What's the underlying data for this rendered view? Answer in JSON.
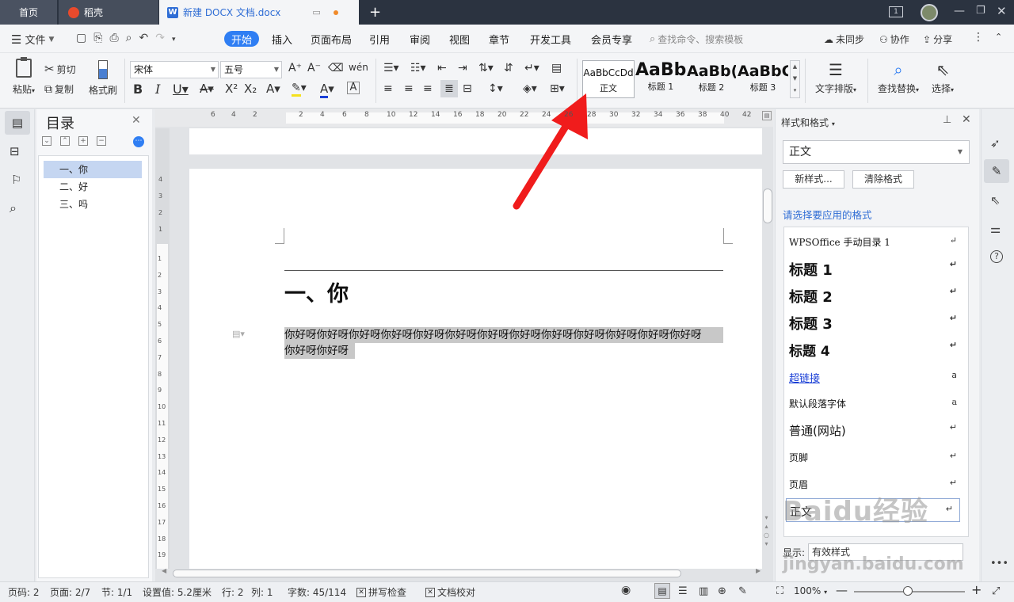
{
  "tabs": {
    "home": "首页",
    "daoke": "稻壳",
    "doc": "新建 DOCX 文档.docx"
  },
  "titlebar": {
    "page_count": "1"
  },
  "menu": {
    "file": "文件",
    "items": [
      "开始",
      "插入",
      "页面布局",
      "引用",
      "审阅",
      "视图",
      "章节",
      "开发工具",
      "会员专享"
    ],
    "search": "查找命令、搜索模板",
    "sync": "未同步",
    "collab": "协作",
    "share": "分享"
  },
  "ribbon": {
    "paste": "粘贴",
    "cut": "剪切",
    "copy": "复制",
    "format_painter": "格式刷",
    "font_name": "宋体",
    "font_size": "五号",
    "styles": [
      {
        "sample": "AaBbCcDd",
        "caption": "正文"
      },
      {
        "sample": "AaBb",
        "caption": "标题 1"
      },
      {
        "sample": "AaBb(",
        "caption": "标题 2"
      },
      {
        "sample": "AaBbC",
        "caption": "标题 3"
      }
    ],
    "text_layout": "文字排版",
    "find_replace": "查找替换",
    "select": "选择"
  },
  "toc": {
    "title": "目录",
    "items": [
      "一、你",
      "二、好",
      "三、吗"
    ]
  },
  "ruler": {
    "h_ticks": [
      "6",
      "4",
      "2",
      "2",
      "4",
      "6",
      "8",
      "10",
      "12",
      "14",
      "16",
      "18",
      "20",
      "22",
      "24",
      "26",
      "28",
      "30",
      "32",
      "34",
      "36",
      "38",
      "40",
      "42"
    ],
    "v_ticks_top": [
      "4",
      "3",
      "2",
      "1"
    ],
    "v_ticks": [
      "1",
      "2",
      "3",
      "4",
      "5",
      "6",
      "7",
      "8",
      "9",
      "10",
      "11",
      "12",
      "13",
      "14",
      "15",
      "16",
      "17",
      "18",
      "19"
    ]
  },
  "document": {
    "heading": "一、你",
    "paragraph_line1": "你好呀你好呀你好呀你好呀你好呀你好呀你好呀你好呀你好呀你好呀你好呀你好呀你好呀",
    "paragraph_line2": "你好呀你好呀"
  },
  "styles_panel": {
    "title": "样式和格式",
    "current": "正文",
    "new_style": "新样式...",
    "clear_format": "清除格式",
    "prompt": "请选择要应用的格式",
    "list": [
      {
        "label": "WPSOffice 手动目录 1",
        "mark": "↵"
      },
      {
        "label": "标题 1",
        "mark": "↵"
      },
      {
        "label": "标题 2",
        "mark": "↵"
      },
      {
        "label": "标题 3",
        "mark": "↵"
      },
      {
        "label": "标题 4",
        "mark": "↵"
      },
      {
        "label": "超链接",
        "mark": "a"
      },
      {
        "label": "默认段落字体",
        "mark": "a"
      },
      {
        "label": "普通(网站)",
        "mark": "↵"
      },
      {
        "label": "页脚",
        "mark": "↵"
      },
      {
        "label": "页眉",
        "mark": "↵"
      },
      {
        "label": "正文",
        "mark": "↵"
      }
    ],
    "show_label": "显示:",
    "show_value": "有效样式"
  },
  "status": {
    "page": "页码: 2",
    "pages": "页面: 2/7",
    "section": "节: 1/1",
    "setting": "设置值: 5.2厘米",
    "row": "行: 2",
    "col": "列: 1",
    "words": "字数: 45/114",
    "spell": "拼写检查",
    "proof": "文档校对",
    "zoom": "100%"
  },
  "watermark": {
    "brand": "Baidu经验",
    "url": "jingyan.baidu.com"
  },
  "colors": {
    "accent": "#2f7ef3",
    "titlebar": "#2b3340",
    "arrow": "#f01c1c",
    "selection": "#c8c8c8"
  }
}
